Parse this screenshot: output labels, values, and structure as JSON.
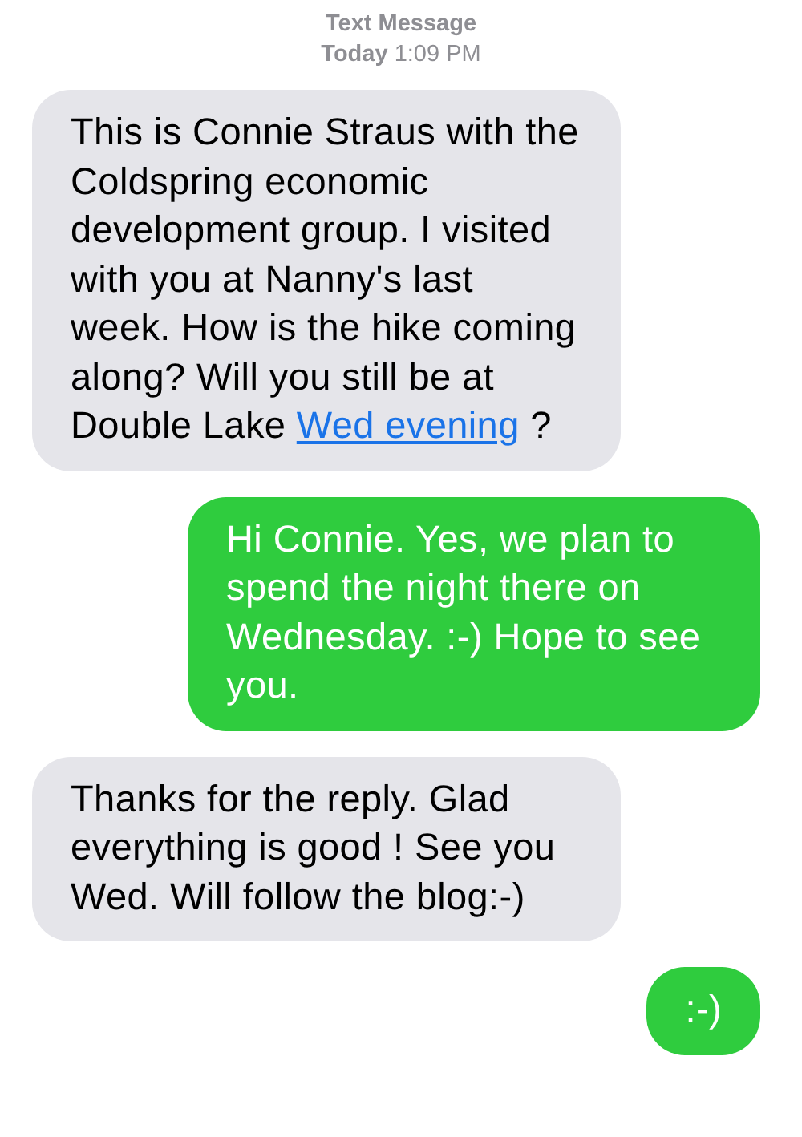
{
  "header": {
    "title": "Text Message",
    "timestamp": "**Today** 1:09 PM"
  },
  "messages": [
    {
      "kind": "incoming",
      "text": "This is Connie Straus with the Coldspring economic development group. I visited with you at Nanny's last week. How is the hike coming along? Will you still be at Double Lake ",
      "link": "Wed evening",
      "text_after": " ?"
    },
    {
      "kind": "outgoing",
      "text": "Hi Connie. Yes, we plan to spend the night there on Wednesday. :-) Hope to see you."
    },
    {
      "kind": "incoming",
      "text": "Thanks for the reply. Glad everything is good ! See you Wed. Will follow the blog:-)"
    },
    {
      "kind": "outgoing",
      "text": ":-)"
    }
  ]
}
